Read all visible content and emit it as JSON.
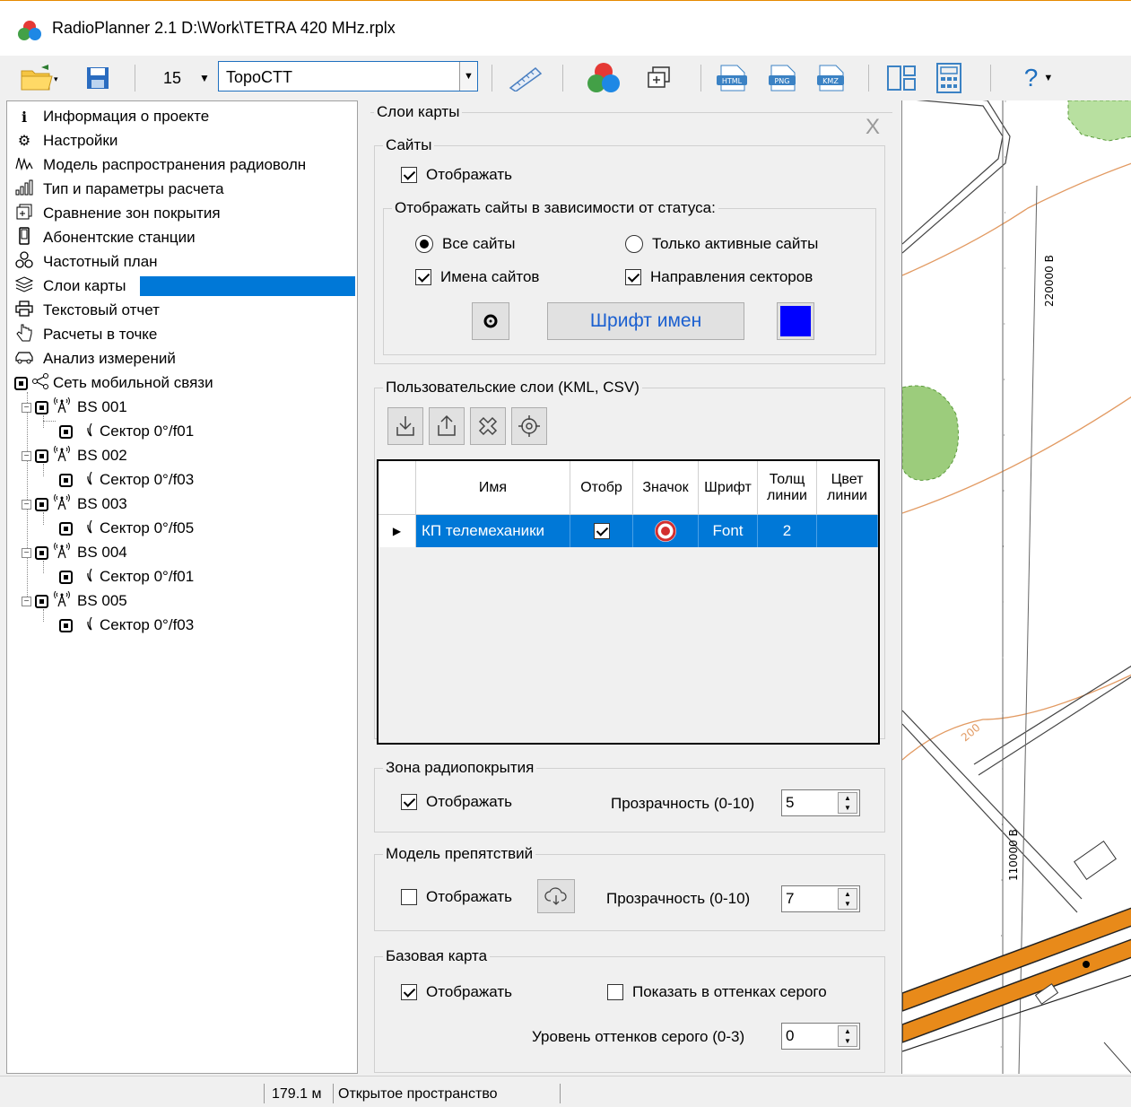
{
  "window": {
    "title": "RadioPlanner 2.1 D:\\Work\\TETRA 420 MHz.rplx"
  },
  "toolbar": {
    "zoom": "15",
    "basemap": "TopoCTT",
    "help_label": "?",
    "icons": [
      "open-folder-icon",
      "save-icon",
      "ruler-icon",
      "color-circles-icon",
      "frame-icon",
      "html-export-icon",
      "png-export-icon",
      "kmz-export-icon",
      "layout-icon",
      "calculator-icon",
      "help-icon"
    ]
  },
  "tree": {
    "items": [
      {
        "label": "Информация о проекте",
        "icon": "info-icon"
      },
      {
        "label": "Настройки",
        "icon": "gear-icon"
      },
      {
        "label": "Модель распространения радиоволн",
        "icon": "wave-icon"
      },
      {
        "label": "Тип и параметры расчета",
        "icon": "bars-icon"
      },
      {
        "label": "Сравнение зон покрытия",
        "icon": "compare-icon"
      },
      {
        "label": "Абонентские станции",
        "icon": "phone-icon"
      },
      {
        "label": "Частотный план",
        "icon": "frequency-icon"
      },
      {
        "label": "Слои карты",
        "icon": "layers-icon"
      },
      {
        "label": "Текстовый отчет",
        "icon": "printer-icon"
      },
      {
        "label": "Расчеты в точке",
        "icon": "point-icon"
      },
      {
        "label": "Анализ измерений",
        "icon": "car-icon"
      },
      {
        "label": "Сеть мобильной связи",
        "icon": "network-icon"
      }
    ],
    "sites": [
      {
        "name": "BS 001",
        "sector": "Сектор 0°/f01"
      },
      {
        "name": "BS 002",
        "sector": "Сектор 0°/f03"
      },
      {
        "name": "BS 003",
        "sector": "Сектор 0°/f05"
      },
      {
        "name": "BS 004",
        "sector": "Сектор 0°/f01"
      },
      {
        "name": "BS 005",
        "sector": "Сектор 0°/f03"
      }
    ]
  },
  "panel": {
    "title": "Слои карты",
    "close": "X",
    "sites": {
      "title": "Сайты",
      "show": "Отображать",
      "status_title": "Отображать сайты в зависимости от статуса:",
      "all_sites": "Все сайты",
      "active_only": "Только активные сайты",
      "site_names": "Имена сайтов",
      "sector_dirs": "Направления секторов",
      "font_button": "Шрифт имен",
      "color": "#0000ff"
    },
    "user_layers": {
      "title": "Пользовательские слои (KML, CSV)",
      "columns": [
        "Имя",
        "Отобр",
        "Значок",
        "Шрифт",
        "Толщ линии",
        "Цвет линии"
      ],
      "rows": [
        {
          "name": "КП телемеханики",
          "visible": true,
          "font": "Font",
          "width": "2"
        }
      ]
    },
    "coverage": {
      "title": "Зона радиопокрытия",
      "show": "Отображать",
      "transparency_label": "Прозрачность (0-10)",
      "transparency": "5"
    },
    "obstacles": {
      "title": "Модель препятствий",
      "show": "Отображать",
      "transparency_label": "Прозрачность (0-10)",
      "transparency": "7"
    },
    "basemap": {
      "title": "Базовая карта",
      "show": "Отображать",
      "grayscale": "Показать в оттенках серого",
      "gray_level_label": "Уровень оттенков серого (0-3)",
      "gray_level": "0"
    }
  },
  "map": {
    "label_top": "220000 В",
    "label_bottom": "110000 В",
    "contour": "200"
  },
  "status": {
    "distance": "179.1 м",
    "terrain": "Открытое пространство"
  }
}
